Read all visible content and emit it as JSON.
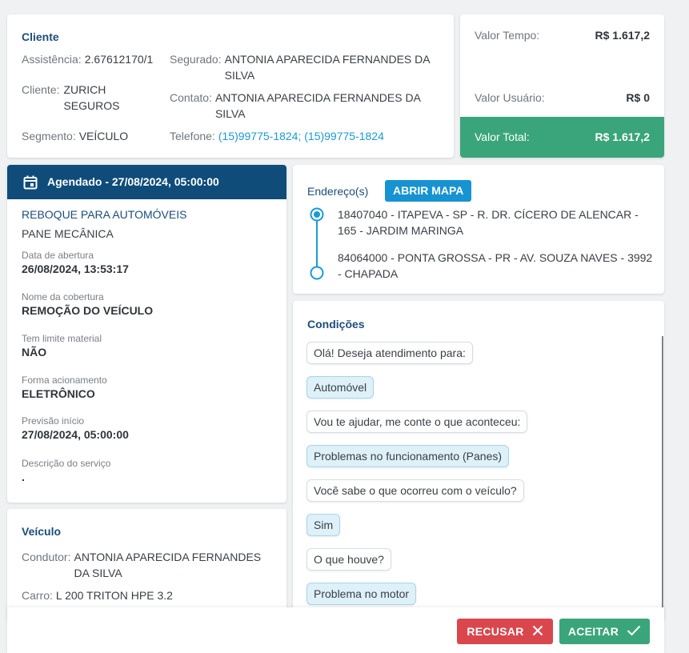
{
  "client_card": {
    "title": "Cliente",
    "assistencia_label": "Assistência:",
    "assistencia_value": "2.67612170/1",
    "cliente_label": "Cliente:",
    "cliente_value": "ZURICH SEGUROS",
    "segmento_label": "Segmento:",
    "segmento_value": "VEÍCULO",
    "segurado_label": "Segurado:",
    "segurado_value": "ANTONIA APARECIDA FERNANDES DA SILVA",
    "contato_label": "Contato:",
    "contato_value": "ANTONIA APARECIDA FERNANDES DA SILVA",
    "telefone_label": "Telefone:",
    "telefone_value": "(15)99775-1824; (15)99775-1824"
  },
  "values_card": {
    "tempo_label": "Valor Tempo:",
    "tempo_value": "R$ 1.617,2",
    "usuario_label": "Valor Usuário:",
    "usuario_value": "R$ 0",
    "total_label": "Valor Total:",
    "total_value": "R$ 1.617,2",
    "total_bg": "#3aa57a"
  },
  "schedule_card": {
    "header": "Agendado - 27/08/2024, 05:00:00",
    "header_bg": "#0f4c7a",
    "service_title": "REBOQUE PARA AUTOMÓVEIS",
    "service_sub": "PANE MECÂNICA",
    "fields": [
      {
        "label": "Data de abertura",
        "value": "26/08/2024, 13:53:17"
      },
      {
        "label": "Nome da cobertura",
        "value": "REMOÇÃO DO VEÍCULO"
      },
      {
        "label": "Tem limite material",
        "value": "NÃO"
      },
      {
        "label": "Forma acionamento",
        "value": "ELETRÔNICO"
      },
      {
        "label": "Previsão início",
        "value": "27/08/2024, 05:00:00"
      },
      {
        "label": "Descrição do serviço",
        "value": "."
      }
    ]
  },
  "vehicle_card": {
    "title": "Veículo",
    "condutor_label": "Condutor:",
    "condutor_value": "ANTONIA APARECIDA FERNANDES DA SILVA",
    "carro_label": "Carro:",
    "carro_value": "L 200 TRITON HPE 3.2"
  },
  "address_card": {
    "title": "Endereço(s)",
    "map_button": "ABRIR MAPA",
    "origin": "18407040 - ITAPEVA - SP - R. DR. CÍCERO DE ALENCAR - 165 - JARDIM MARINGA",
    "destination": "84064000 - PONTA GROSSA - PR - AV. SOUZA NAVES - 3992 - CHAPADA"
  },
  "conditions_card": {
    "title": "Condições",
    "messages": [
      {
        "text": "Olá! Deseja atendimento para:",
        "from": "bot"
      },
      {
        "text": "Automóvel",
        "from": "user"
      },
      {
        "text": "Vou te ajudar, me conte o que aconteceu:",
        "from": "bot"
      },
      {
        "text": "Problemas no funcionamento (Panes)",
        "from": "user"
      },
      {
        "text": "Você sabe o que ocorreu com o veículo?",
        "from": "bot"
      },
      {
        "text": "Sim",
        "from": "user"
      },
      {
        "text": "O que houve?",
        "from": "bot"
      },
      {
        "text": "Problema no motor",
        "from": "user"
      }
    ]
  },
  "footer": {
    "reject_label": "RECUSAR",
    "accept_label": "ACEITAR",
    "reject_color": "#d9474d",
    "accept_color": "#3aa57a"
  }
}
